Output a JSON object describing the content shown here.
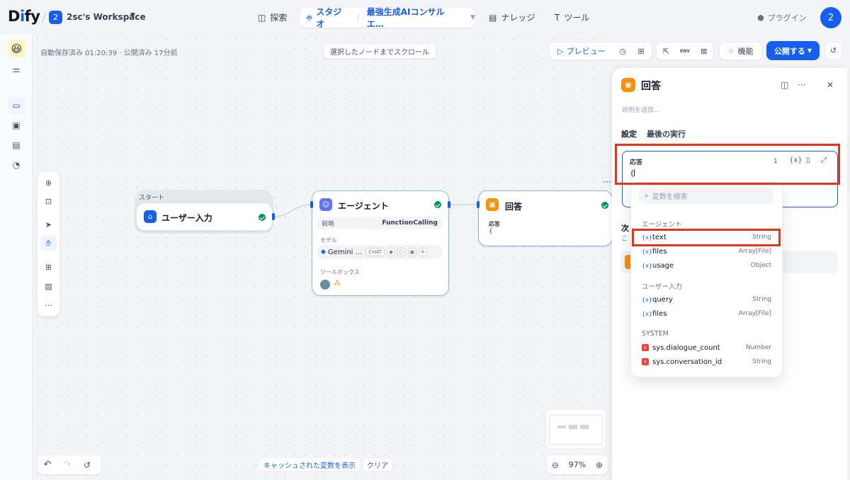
{
  "header": {
    "logo": "Dify",
    "workspace_badge": "2",
    "workspace_name": "2sc's Workspace",
    "nav": {
      "explore": "探索",
      "studio": "スタジオ",
      "app_name": "最強生成AIコンサルエ…",
      "knowledge": "ナレッジ",
      "tools": "ツール"
    },
    "plugin": "プラグイン",
    "avatar": "2"
  },
  "toolbar": {
    "status": "自動保存済み 01:20:39 · 公開済み 17分前",
    "scroll_to_node": "選択したノードまでスクロール",
    "preview": "プレビュー",
    "env": "ENV",
    "features": "機能",
    "publish": "公開する"
  },
  "canvas": {
    "start_label": "スタート",
    "user_input_node": "ユーザー入力",
    "agent_node": {
      "title": "エージェント",
      "strategy_key": "戦略",
      "strategy_value": "FunctionCalling",
      "model_label": "モデル",
      "model_name": "Gemini ...",
      "model_chip": "CHAT",
      "toolbox_label": "ツールボックス"
    },
    "answer_node": {
      "title": "回答",
      "field_label": "応答",
      "field_value": "{"
    },
    "cache_vars": "キャッシュされた変数を表示",
    "clear": "クリア",
    "zoom": "97%"
  },
  "panel": {
    "title": "回答",
    "description_placeholder": "説明を追加...",
    "tabs": [
      "設定",
      "最後の実行"
    ],
    "response_label": "応答",
    "line_count": "1",
    "response_text": "{",
    "next_label": "次",
    "next_sub": "こ"
  },
  "dropdown": {
    "search_placeholder": "変数を検索",
    "groups": [
      {
        "label": "エージェント",
        "vars": [
          {
            "name": "text",
            "type": "String"
          },
          {
            "name": "files",
            "type": "Array[File]"
          },
          {
            "name": "usage",
            "type": "Object"
          }
        ]
      },
      {
        "label": "ユーザー入力",
        "vars": [
          {
            "name": "query",
            "type": "String"
          },
          {
            "name": "files",
            "type": "Array[File]"
          }
        ]
      },
      {
        "label": "SYSTEM",
        "vars": [
          {
            "name": "sys.dialogue_count",
            "type": "Number"
          },
          {
            "name": "sys.conversation_id",
            "type": "String"
          }
        ]
      }
    ]
  },
  "colors": {
    "accent": "#155eef",
    "answer_node": "#f79009",
    "success": "#079455",
    "highlight": "#e8341c"
  }
}
